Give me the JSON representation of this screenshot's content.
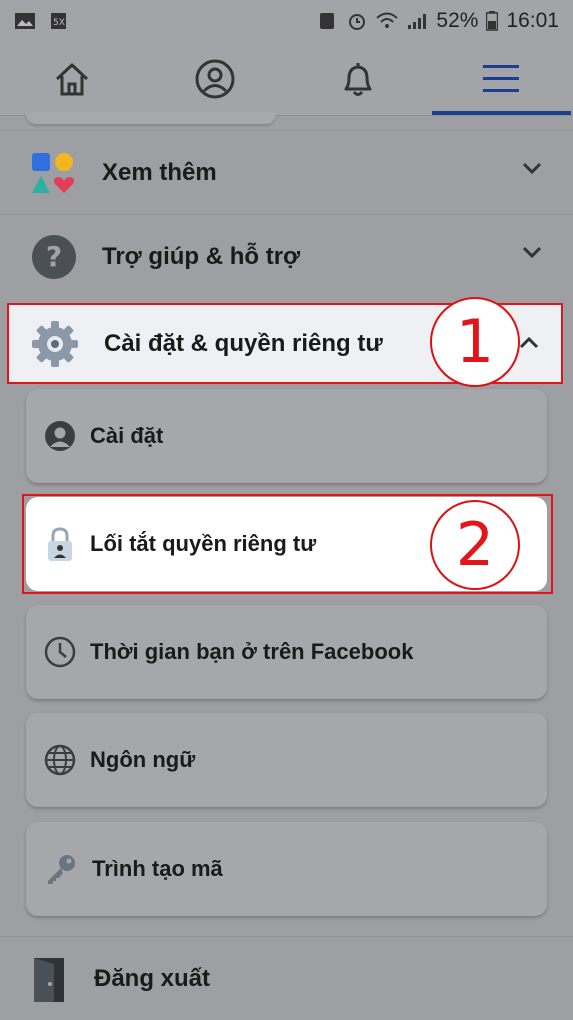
{
  "status_bar": {
    "battery": "52%",
    "time": "16:01"
  },
  "nav": {
    "tabs": [
      "home-icon",
      "profile-icon",
      "notifications-icon",
      "menu-icon"
    ],
    "active": "menu-icon",
    "active_color": "#1b3f8f"
  },
  "menu": {
    "see_more": "Xem thêm",
    "help_support": "Trợ giúp & hỗ trợ",
    "settings_privacy": "Cài đặt & quyền riêng tư",
    "sub_items": [
      {
        "label": "Cài đặt",
        "icon": "profile-icon"
      },
      {
        "label": "Lối tắt quyền riêng tư",
        "icon": "lock-icon"
      },
      {
        "label": "Thời gian bạn ở trên Facebook",
        "icon": "clock-icon"
      },
      {
        "label": "Ngôn ngữ",
        "icon": "globe-icon"
      },
      {
        "label": "Trình tạo mã",
        "icon": "key-icon"
      }
    ],
    "logout": "Đăng xuất"
  },
  "annotations": {
    "step1": "1",
    "step2": "2",
    "color": "#e0161b"
  }
}
